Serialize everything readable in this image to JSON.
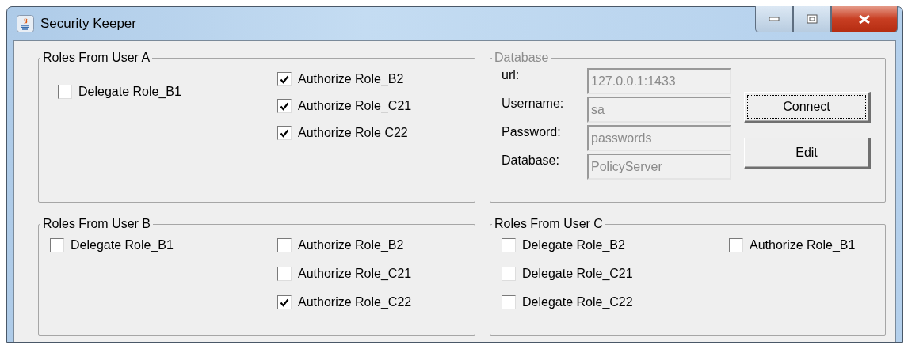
{
  "window": {
    "title": "Security Keeper"
  },
  "panels": [
    {
      "kind": "checkboxes",
      "title": "Roles From User A",
      "columns": [
        [
          {
            "label": "Delegate Role_B1",
            "checked": false
          }
        ],
        [
          {
            "label": "Authorize Role_B2",
            "checked": true
          },
          {
            "label": "Authorize Role_C21",
            "checked": true
          },
          {
            "label": "Authorize Role C22",
            "checked": true
          }
        ]
      ]
    },
    {
      "kind": "database",
      "title": "Database",
      "disabled": true,
      "fields": [
        {
          "label": "url:",
          "value": "127.0.0.1:1433"
        },
        {
          "label": "Username:",
          "value": "sa"
        },
        {
          "label": "Password:",
          "value": "passwords"
        },
        {
          "label": "Database:",
          "value": "PolicyServer"
        }
      ],
      "buttons": [
        {
          "label": "Connect",
          "focused": true
        },
        {
          "label": "Edit",
          "focused": false
        }
      ]
    },
    {
      "kind": "checkboxes",
      "title": "Roles From User B",
      "columns": [
        [
          {
            "label": "Delegate Role_B1",
            "checked": false
          }
        ],
        [
          {
            "label": "Authorize Role_B2",
            "checked": false
          },
          {
            "label": "Authorize Role_C21",
            "checked": false
          },
          {
            "label": "Authorize Role_C22",
            "checked": true
          }
        ]
      ]
    },
    {
      "kind": "checkboxes",
      "title": "Roles From User C",
      "columns": [
        [
          {
            "label": "Delegate Role_B2",
            "checked": false
          },
          {
            "label": "Delegate Role_C21",
            "checked": false
          },
          {
            "label": "Delegate Role_C22",
            "checked": false
          }
        ],
        [
          {
            "label": "Authorize Role_B1",
            "checked": false
          }
        ]
      ]
    }
  ]
}
